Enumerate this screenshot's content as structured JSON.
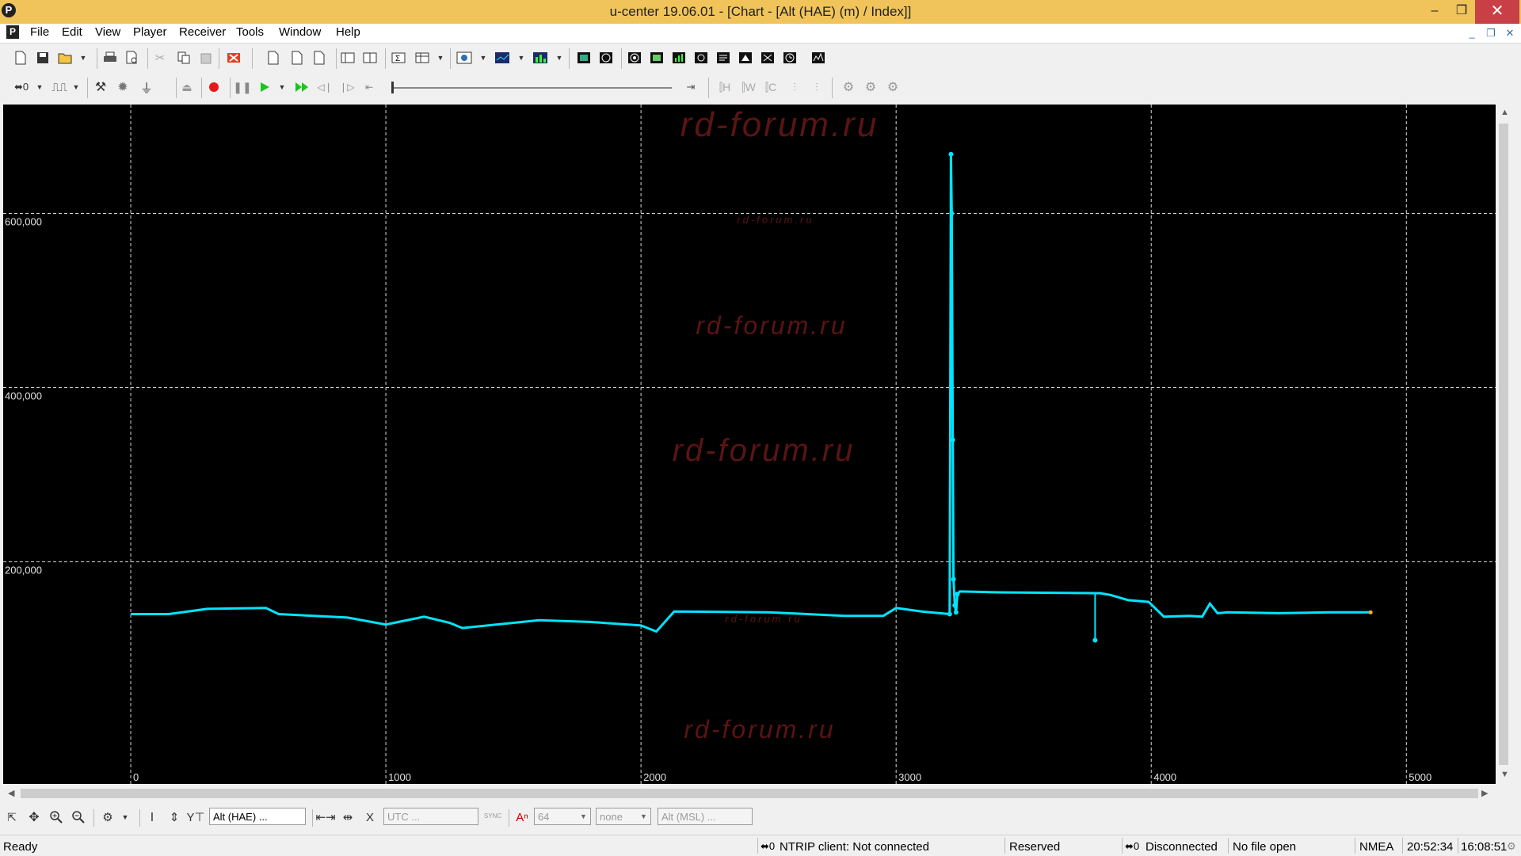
{
  "window": {
    "title": "u-center 19.06.01 - [Chart - [Alt (HAE) (m) / Index]]",
    "app_icon": "u-center-icon",
    "minimize": "–",
    "maximize": "❐",
    "close": "✕"
  },
  "menubar": {
    "items": [
      "File",
      "Edit",
      "View",
      "Player",
      "Receiver",
      "Tools",
      "Window",
      "Help"
    ],
    "mdi_controls": [
      "_",
      "❐",
      "✕"
    ]
  },
  "watermarks": [
    "rd-forum.ru",
    "rd-forum.ru",
    "rd-forum.ru",
    "rd-forum.ru",
    "rd-forum.ru",
    "rd-forum.ru"
  ],
  "chart_data": {
    "type": "line",
    "title": "",
    "xlabel": "",
    "ylabel": "",
    "xlim": [
      -500,
      5350
    ],
    "ylim": [
      -55000,
      725000
    ],
    "x_ticks": [
      0,
      1000,
      2000,
      3000,
      4000,
      5000
    ],
    "y_ticks": [
      200000,
      400000,
      600000
    ],
    "x_tick_labels": [
      "0",
      "1000",
      "2000",
      "3000",
      "4000",
      "5000"
    ],
    "y_tick_labels": [
      "200,000",
      "400,000",
      "600,000"
    ],
    "grid": true,
    "line_color": "#00e5ff",
    "series": [
      {
        "x": [
          0,
          150,
          300,
          530,
          580,
          850,
          1000,
          1150,
          1250,
          1300,
          1600,
          1800,
          2000,
          2060,
          2130,
          2500,
          2800,
          2950,
          3000,
          3100,
          3210,
          3215,
          3218,
          3222,
          3225,
          3230,
          3235,
          3240,
          3250,
          3400,
          3800,
          3840,
          3910,
          3990,
          4050,
          4150,
          4200,
          4230,
          4260,
          4300,
          4500,
          4700,
          4860
        ],
        "y": [
          140000,
          140000,
          146000,
          147000,
          140000,
          136000,
          128000,
          137000,
          130000,
          124000,
          133000,
          131000,
          127000,
          120000,
          143000,
          142000,
          138000,
          138000,
          147000,
          143000,
          140000,
          668000,
          600000,
          340000,
          180000,
          150000,
          142000,
          163000,
          166000,
          165000,
          164000,
          162000,
          156000,
          154000,
          137000,
          138000,
          137000,
          152000,
          141000,
          142000,
          141000,
          142000,
          142000
        ]
      }
    ],
    "excursions": [
      {
        "x": 3780,
        "y": 110000
      }
    ]
  },
  "player": {
    "position": 0
  },
  "bottom_bar": {
    "field1": "Alt (HAE) ...",
    "utc": "UTC ...",
    "sync": "SYNC",
    "count": "64",
    "none": "none",
    "field2": "Alt (MSL) ..."
  },
  "statusbar": {
    "ready": "Ready",
    "ntrip": "NTRIP client: Not connected",
    "reserved": "Reserved",
    "connection": "Disconnected",
    "file": "No file open",
    "protocol": "NMEA",
    "time1": "20:52:34",
    "time2": "16:08:51"
  }
}
